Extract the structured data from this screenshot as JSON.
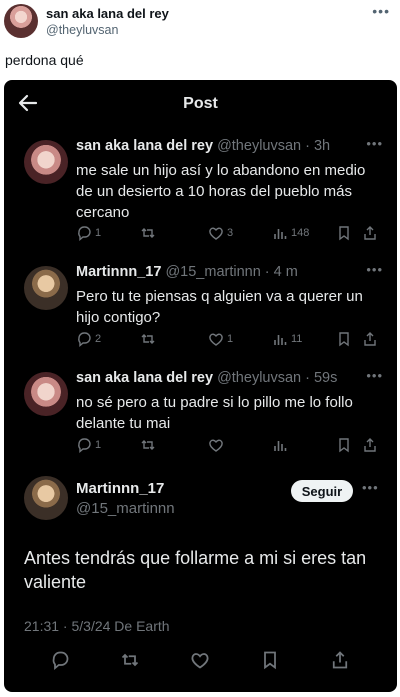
{
  "outer": {
    "display_name": "san aka lana del rey",
    "handle": "@theyluvsan",
    "more_icon": "•••",
    "text": "perdona qué"
  },
  "screen": {
    "back_icon": "arrow-left-icon",
    "title": "Post",
    "replies": [
      {
        "name": "san aka lana del rey",
        "handle": "@theyluvsan · 3h",
        "text": "me sale un hijo así y lo abandono en medio de un desierto a 10 horas del pueblo más cercano",
        "more": "•••",
        "counts": {
          "reply": "1",
          "repost": "",
          "like": "3",
          "views": "148"
        }
      },
      {
        "name": "Martinnn_17",
        "handle": "@15_martinnn · 4 m",
        "text": "Pero tu te piensas q alguien va a querer un hijo contigo?",
        "more": "•••",
        "counts": {
          "reply": "2",
          "repost": "",
          "like": "1",
          "views": "11"
        }
      },
      {
        "name": "san aka lana del rey",
        "handle": "@theyluvsan · 59s",
        "text": "no sé pero a tu padre si lo pillo me lo follo delante tu mai",
        "more": "•••",
        "counts": {
          "reply": "1",
          "repost": "",
          "like": "",
          "views": ""
        }
      }
    ],
    "main": {
      "name": "Martinnn_17",
      "handle": "@15_martinnn",
      "follow_label": "Seguir",
      "more": "•••",
      "text": "Antes tendrás que follarme a mi si eres tan valiente",
      "meta": "21:31 · 5/3/24 De Earth"
    }
  },
  "colors": {
    "dark_bg": "#000000",
    "text_light": "#e7e9ea",
    "text_muted": "#71767b"
  }
}
